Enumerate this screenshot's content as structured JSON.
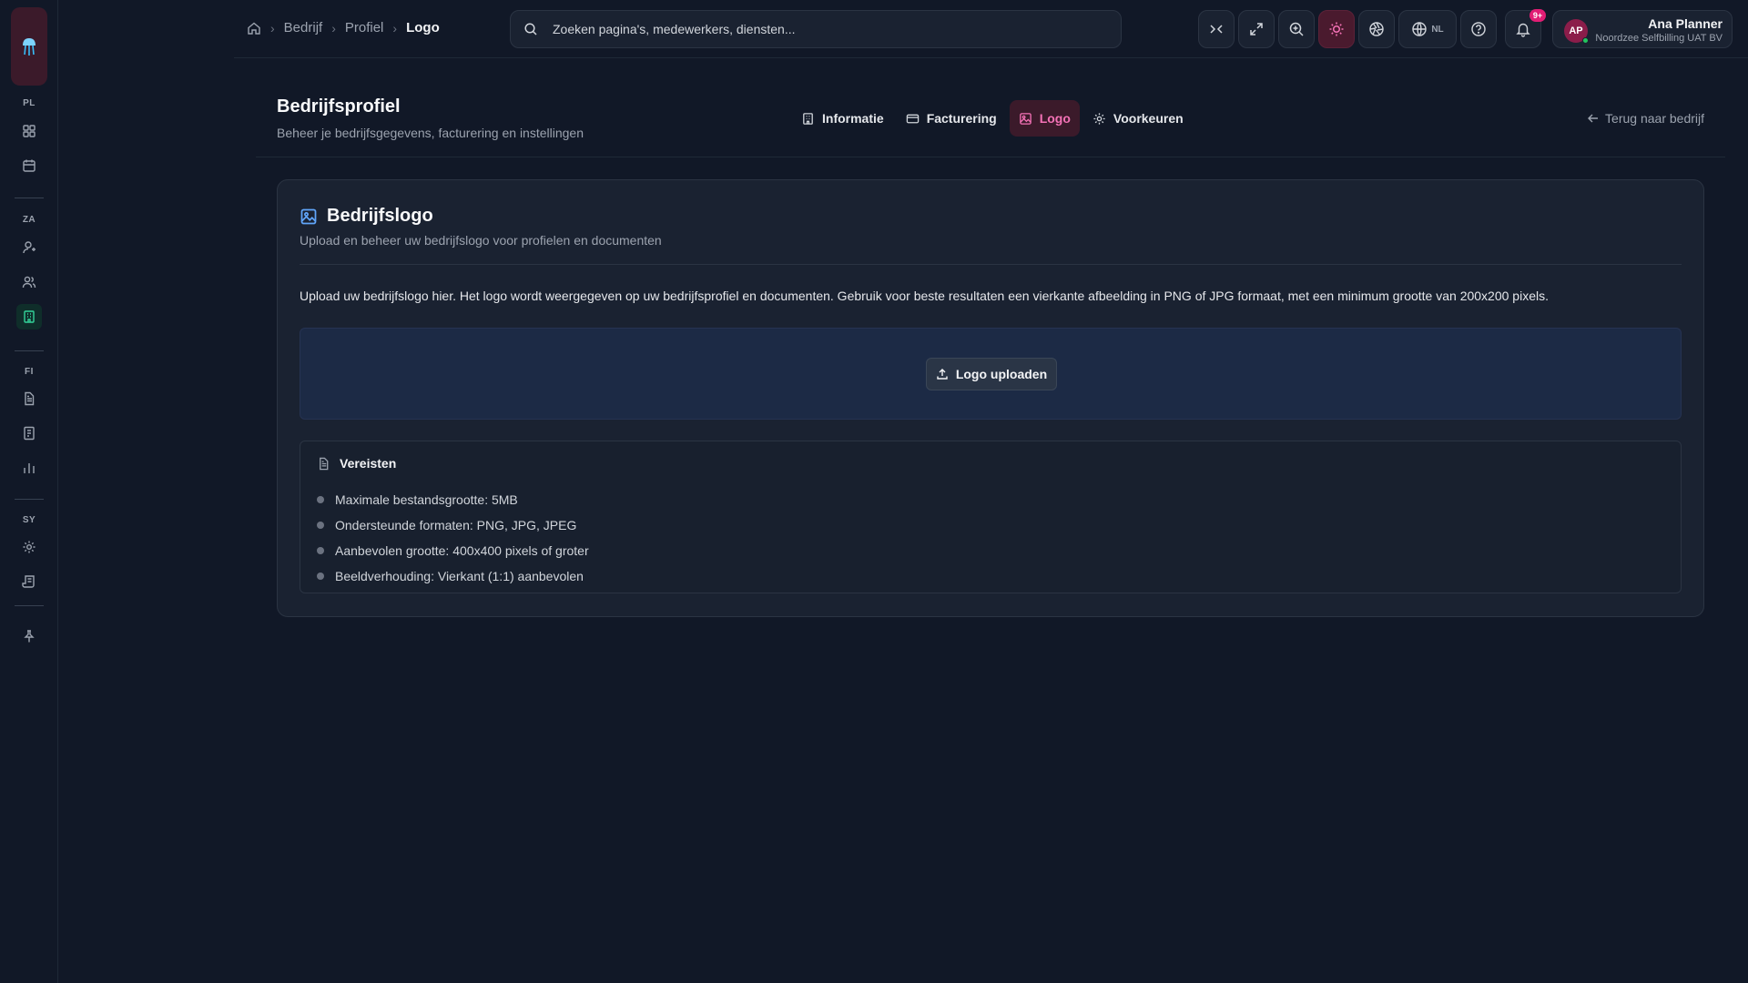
{
  "rail": {
    "sections": [
      "PL",
      "ZA",
      "FI",
      "SY"
    ]
  },
  "breadcrumb": {
    "items": [
      "Bedrijf",
      "Profiel"
    ],
    "current": "Logo"
  },
  "search": {
    "placeholder": "Zoeken pagina's, medewerkers, diensten..."
  },
  "toolbar": {
    "language": "NL",
    "notifications_badge": "9+"
  },
  "user": {
    "initials": "AP",
    "name": "Ana Planner",
    "organization": "Noordzee Selfbilling UAT BV"
  },
  "page": {
    "title": "Bedrijfsprofiel",
    "subtitle": "Beheer je bedrijfsgegevens, facturering en instellingen",
    "back_link": "Terug naar bedrijf"
  },
  "tabs": [
    {
      "label": "Informatie",
      "icon": "building-icon"
    },
    {
      "label": "Facturering",
      "icon": "credit-card-icon"
    },
    {
      "label": "Logo",
      "icon": "image-icon",
      "active": true
    },
    {
      "label": "Voorkeuren",
      "icon": "gear-icon"
    }
  ],
  "card": {
    "title": "Bedrijfslogo",
    "subtitle": "Upload en beheer uw bedrijfslogo voor profielen en documenten",
    "description": "Upload uw bedrijfslogo hier. Het logo wordt weergegeven op uw bedrijfsprofiel en documenten. Gebruik voor beste resultaten een vierkante afbeelding in PNG of JPG formaat, met een minimum grootte van 200x200 pixels.",
    "upload_button": "Logo uploaden"
  },
  "requirements": {
    "title": "Vereisten",
    "items": [
      "Maximale bestandsgrootte: 5MB",
      "Ondersteunde formaten: PNG, JPG, JPEG",
      "Aanbevolen grootte: 400x400 pixels of groter",
      "Beeldverhouding: Vierkant (1:1) aanbevolen"
    ]
  },
  "colors": {
    "background": "#111827",
    "card": "#1a2231",
    "accent_pink": "#f472b6",
    "accent_green": "#34d399",
    "accent_blue": "#60a5fa"
  }
}
